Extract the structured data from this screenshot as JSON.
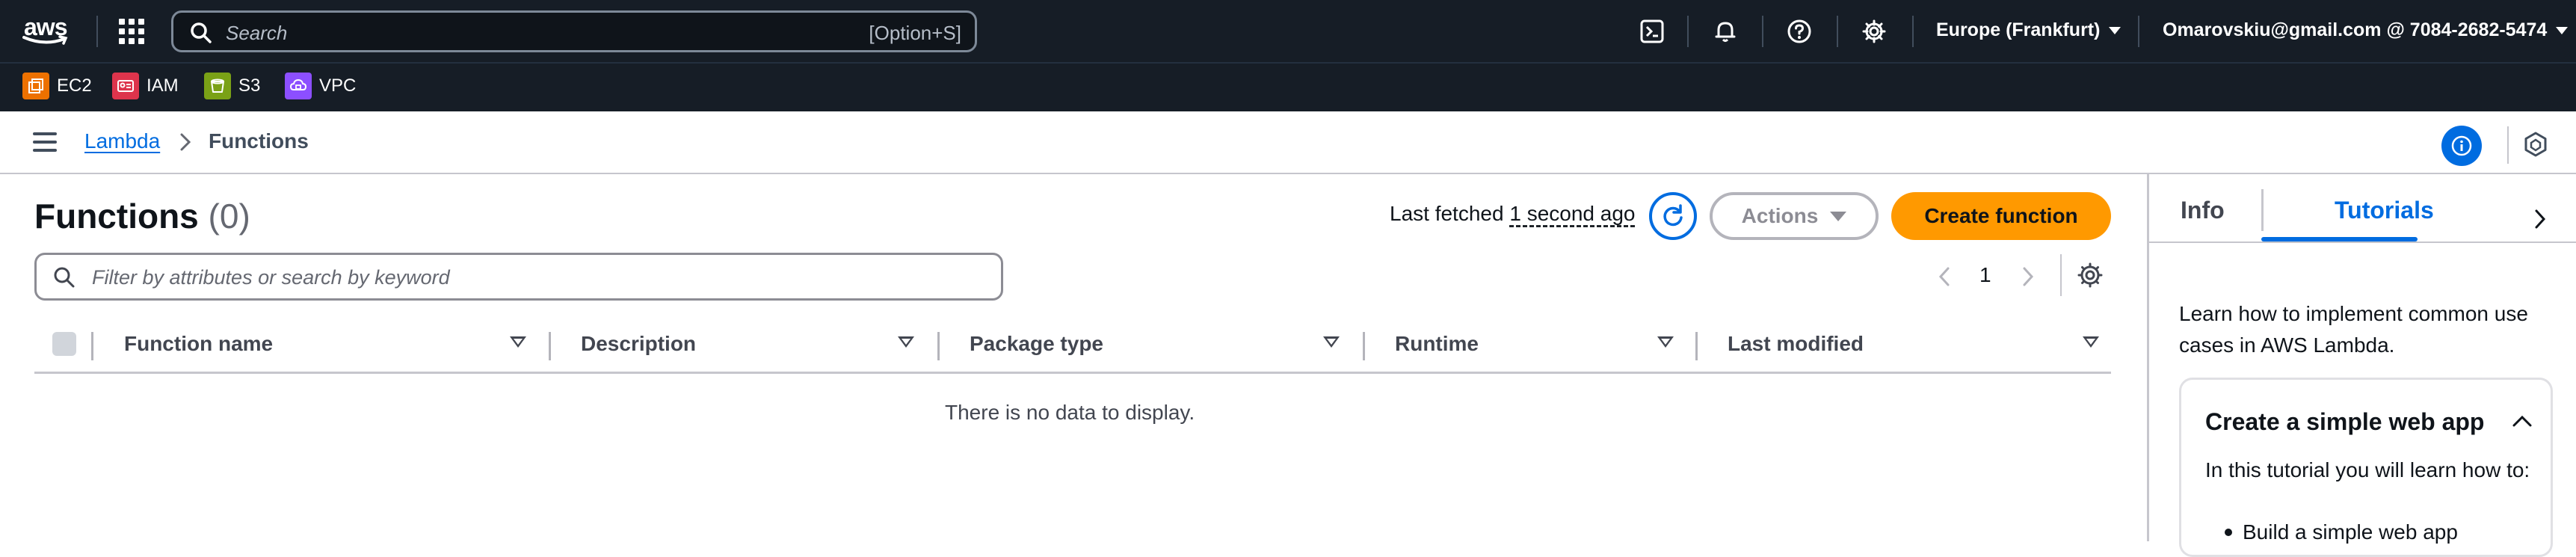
{
  "topnav": {
    "logo_text": "aws",
    "search_placeholder": "Search",
    "search_shortcut": "[Option+S]",
    "region": "Europe (Frankfurt)",
    "account": "Omarovskiu@gmail.com @ 7084-2682-5474",
    "icons": [
      "cloudshell-icon",
      "bell-icon",
      "help-icon",
      "gear-icon"
    ]
  },
  "favorites": [
    {
      "label": "EC2",
      "color": "#ed7100",
      "icon": "ec2-icon"
    },
    {
      "label": "IAM",
      "color": "#dd344c",
      "icon": "iam-icon"
    },
    {
      "label": "S3",
      "color": "#7aa116",
      "icon": "s3-icon"
    },
    {
      "label": "VPC",
      "color": "#8c4fff",
      "icon": "vpc-icon"
    }
  ],
  "breadcrumb": {
    "root": "Lambda",
    "current": "Functions"
  },
  "main": {
    "title": "Functions",
    "count": "(0)",
    "last_fetched_label": "Last fetched",
    "last_fetched_value": "1 second ago",
    "actions_label": "Actions",
    "create_label": "Create function",
    "filter_placeholder": "Filter by attributes or search by keyword",
    "page_number": "1",
    "columns": [
      "Function name",
      "Description",
      "Package type",
      "Runtime",
      "Last modified"
    ],
    "empty_message": "There is no data to display."
  },
  "panel": {
    "tabs": [
      "Info",
      "Tutorials"
    ],
    "active_tab": "Tutorials",
    "intro": "Learn how to implement common use cases in AWS Lambda.",
    "card_title": "Create a simple web app",
    "card_text": "In this tutorial you will learn how to:",
    "card_item": "Build a simple web app"
  },
  "colors": {
    "nav_bg": "#161d26",
    "link": "#006ce0",
    "primary_button": "#ff9900"
  }
}
